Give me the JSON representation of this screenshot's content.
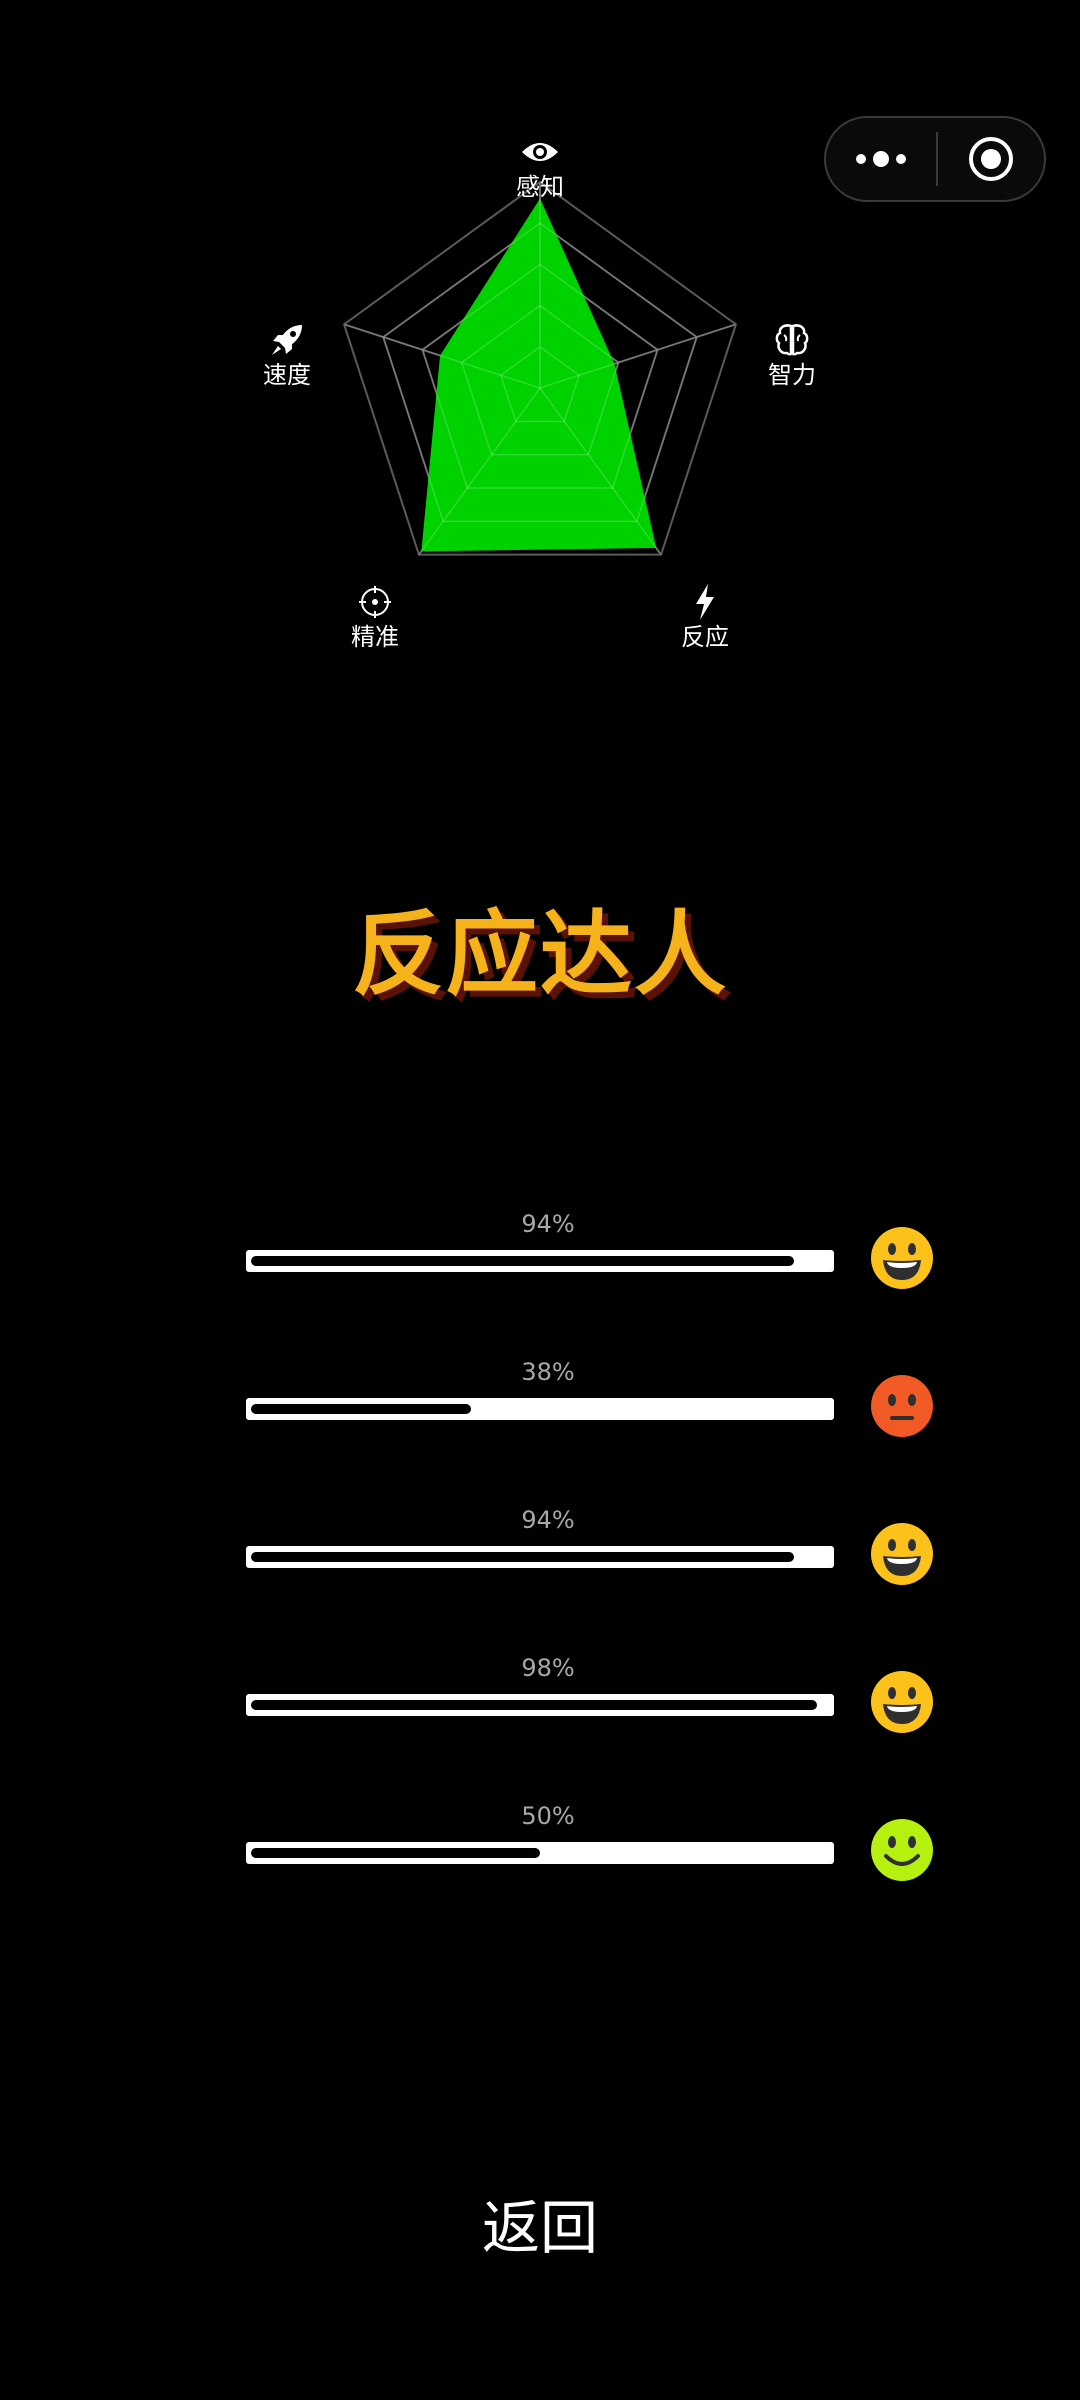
{
  "radar": {
    "axes": [
      {
        "label": "感知",
        "icon": "eye-icon",
        "value": 0.92
      },
      {
        "label": "智力",
        "icon": "brain-icon",
        "value": 0.38
      },
      {
        "label": "反应",
        "icon": "lightning-icon",
        "value": 0.96
      },
      {
        "label": "精准",
        "icon": "crosshair-icon",
        "value": 0.98
      },
      {
        "label": "速度",
        "icon": "rocket-icon",
        "value": 0.51
      }
    ],
    "levels": 5,
    "fill_color": "#00d200",
    "grid_color": "#5a5a5a"
  },
  "title": "反应达人",
  "title_color": "#f5b21b",
  "stats": [
    {
      "percent_text": "94%",
      "value": 0.94,
      "face": "grinning-face-icon",
      "face_color": "#fcc21b"
    },
    {
      "percent_text": "38%",
      "value": 0.38,
      "face": "neutral-face-icon",
      "face_color": "#f15a24"
    },
    {
      "percent_text": "94%",
      "value": 0.94,
      "face": "grinning-face-icon",
      "face_color": "#fcc21b"
    },
    {
      "percent_text": "98%",
      "value": 0.98,
      "face": "grinning-face-icon",
      "face_color": "#fcc21b"
    },
    {
      "percent_text": "50%",
      "value": 0.5,
      "face": "smiling-face-icon",
      "face_color": "#b5f010"
    }
  ],
  "back_label": "返回"
}
